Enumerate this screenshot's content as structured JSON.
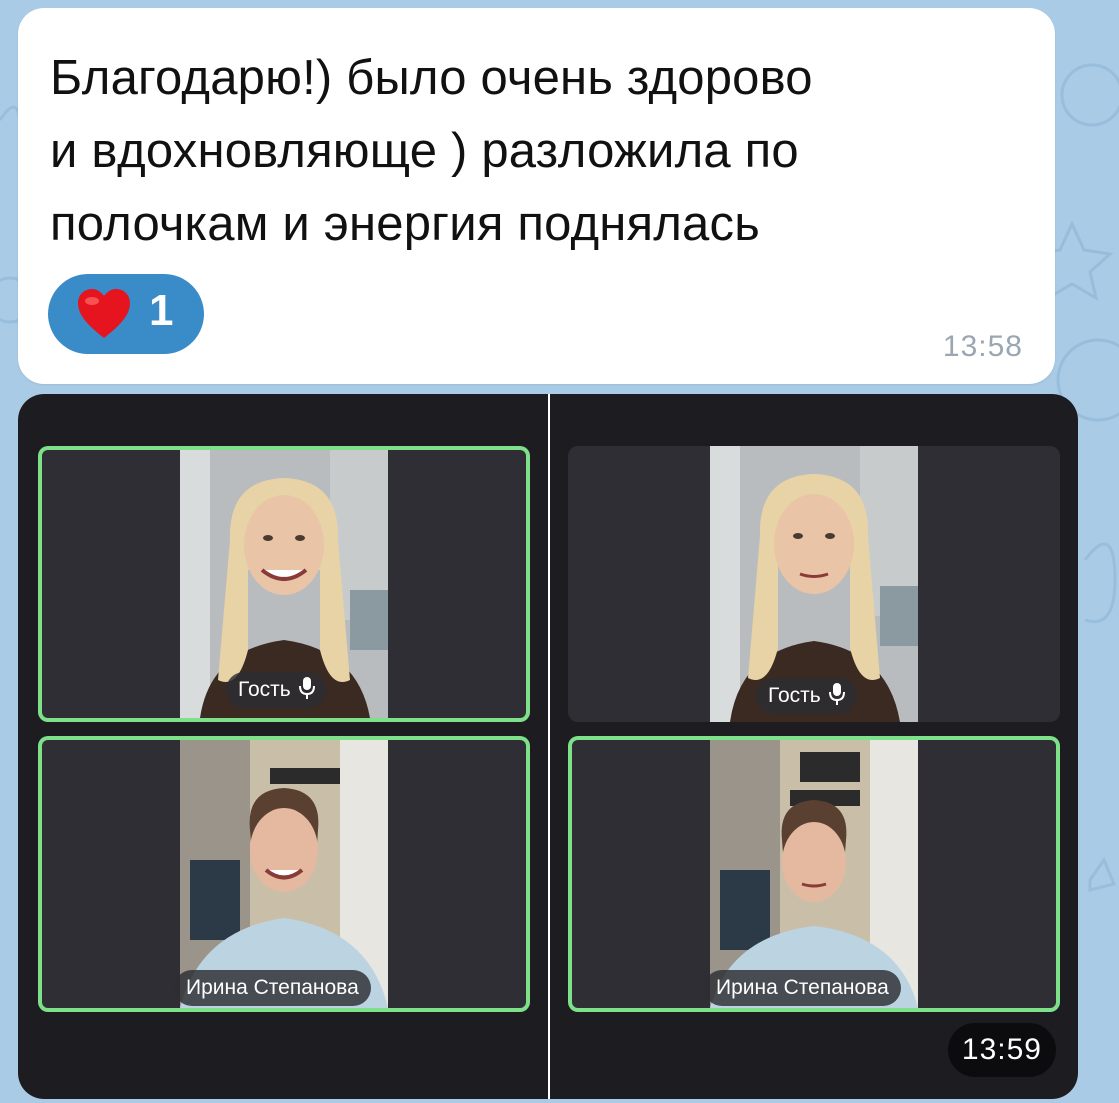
{
  "message": {
    "text": "Благодарю!) было очень здорово\nи вдохновляюще ) разложила по\nполочкам и энергия поднялась",
    "reaction": {
      "emoji_icon": "red-heart-emoji",
      "count": "1"
    },
    "time": "13:58"
  },
  "album": {
    "time": "13:59",
    "photos": [
      {
        "tiles": [
          {
            "name": "Гость",
            "mic_icon": "microphone-icon"
          },
          {
            "name": "Ирина Степанова"
          }
        ]
      },
      {
        "tiles": [
          {
            "name": "Гость",
            "mic_icon": "microphone-icon"
          },
          {
            "name": "Ирина Степанова"
          }
        ]
      }
    ]
  },
  "colors": {
    "chat_background": "#a9cbe6",
    "reaction_pill": "#3a8cc8",
    "speaking_border": "#7fe08a",
    "album_background": "#1c1c21"
  }
}
